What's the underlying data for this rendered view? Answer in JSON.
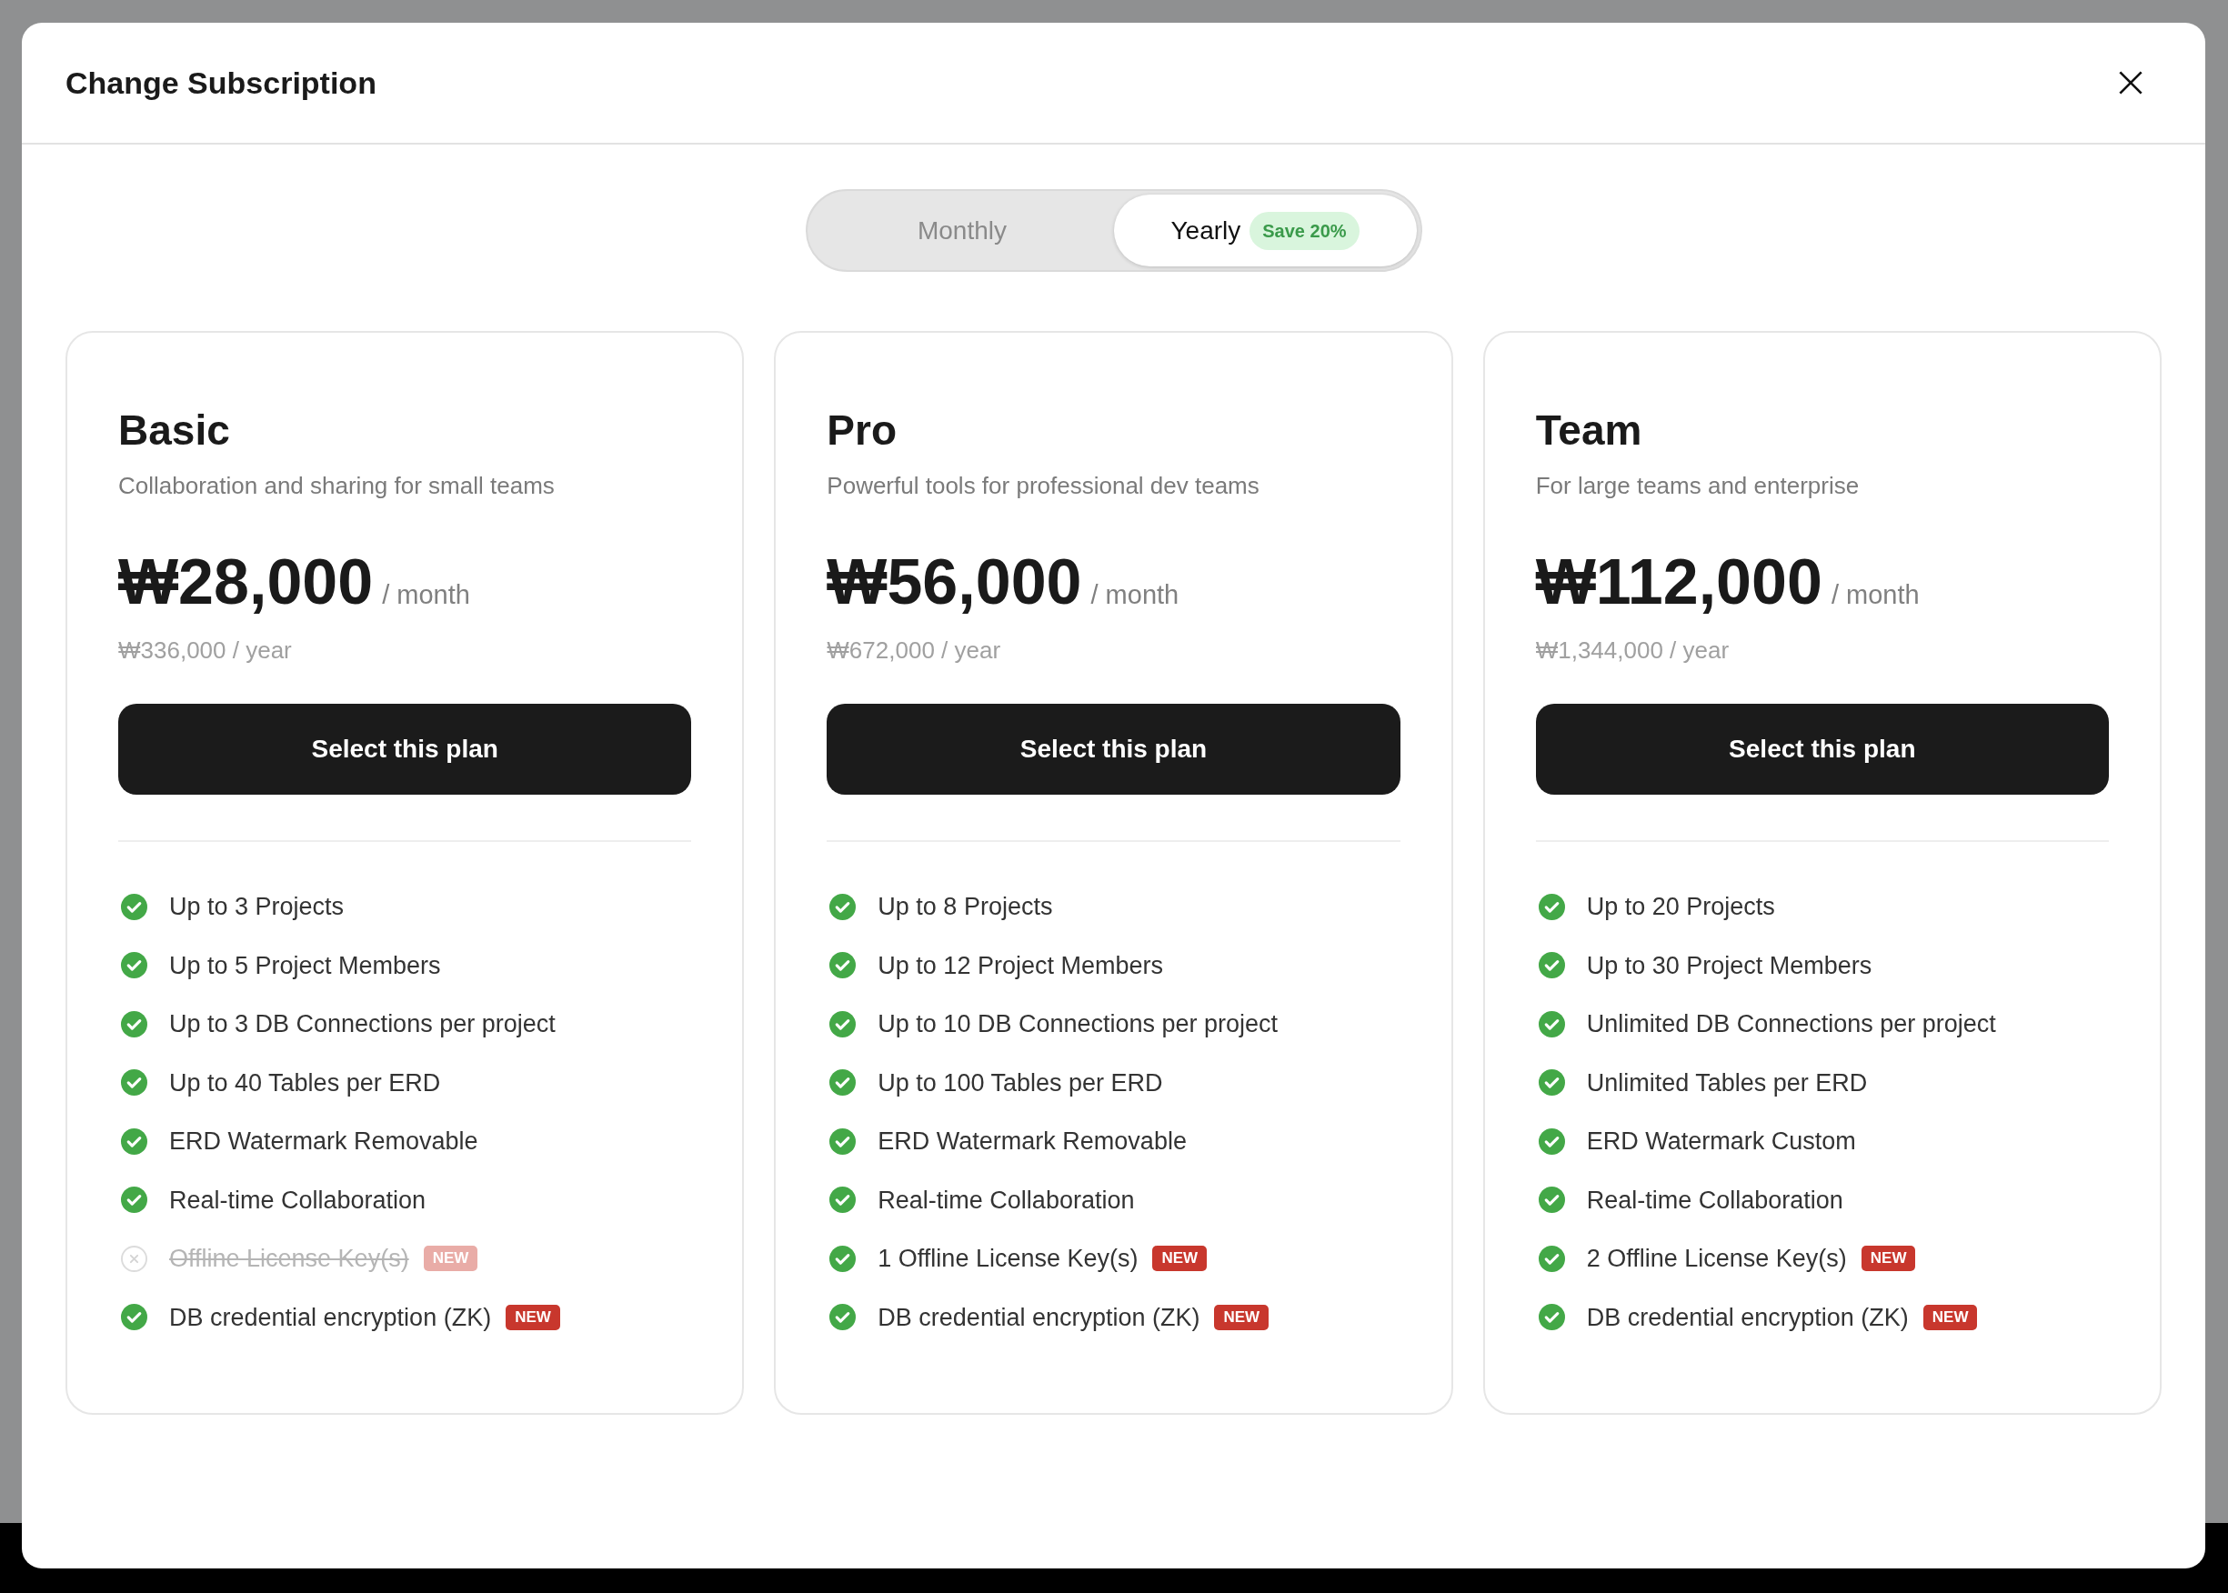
{
  "dialog": {
    "title": "Change Subscription"
  },
  "billing_toggle": [
    {
      "label": "Monthly",
      "selected": false
    },
    {
      "label": "Yearly",
      "selected": true,
      "badge": "Save 20%"
    }
  ],
  "plans": [
    {
      "name": "Basic",
      "description": "Collaboration and sharing for small teams",
      "price": "₩28,000",
      "period": "/ month",
      "yearly_price": "₩336,000 / year",
      "button": "Select this plan",
      "features": [
        {
          "text": "Up to 3 Projects",
          "included": true
        },
        {
          "text": "Up to 5 Project Members",
          "included": true
        },
        {
          "text": "Up to 3 DB Connections per project",
          "included": true
        },
        {
          "text": "Up to 40 Tables per ERD",
          "included": true
        },
        {
          "text": "ERD Watermark Removable",
          "included": true
        },
        {
          "text": "Real-time Collaboration",
          "included": true
        },
        {
          "text": "Offline License Key(s)",
          "included": false,
          "badge": "NEW"
        },
        {
          "text": "DB credential encryption (ZK)",
          "included": true,
          "badge": "NEW"
        }
      ]
    },
    {
      "name": "Pro",
      "description": "Powerful tools for professional dev teams",
      "price": "₩56,000",
      "period": "/ month",
      "yearly_price": "₩672,000 / year",
      "button": "Select this plan",
      "features": [
        {
          "text": "Up to 8 Projects",
          "included": true
        },
        {
          "text": "Up to 12 Project Members",
          "included": true
        },
        {
          "text": "Up to 10 DB Connections per project",
          "included": true
        },
        {
          "text": "Up to 100 Tables per ERD",
          "included": true
        },
        {
          "text": "ERD Watermark Removable",
          "included": true
        },
        {
          "text": "Real-time Collaboration",
          "included": true
        },
        {
          "text": "1 Offline License Key(s)",
          "included": true,
          "badge": "NEW"
        },
        {
          "text": "DB credential encryption (ZK)",
          "included": true,
          "badge": "NEW"
        }
      ]
    },
    {
      "name": "Team",
      "description": "For large teams and enterprise",
      "price": "₩112,000",
      "period": "/ month",
      "yearly_price": "₩1,344,000 / year",
      "button": "Select this plan",
      "features": [
        {
          "text": "Up to 20 Projects",
          "included": true
        },
        {
          "text": "Up to 30 Project Members",
          "included": true
        },
        {
          "text": "Unlimited DB Connections per project",
          "included": true
        },
        {
          "text": "Unlimited Tables per ERD",
          "included": true
        },
        {
          "text": "ERD Watermark Custom",
          "included": true
        },
        {
          "text": "Real-time Collaboration",
          "included": true
        },
        {
          "text": "2 Offline License Key(s)",
          "included": true,
          "badge": "NEW"
        },
        {
          "text": "DB credential encryption (ZK)",
          "included": true,
          "badge": "NEW"
        }
      ]
    }
  ]
}
